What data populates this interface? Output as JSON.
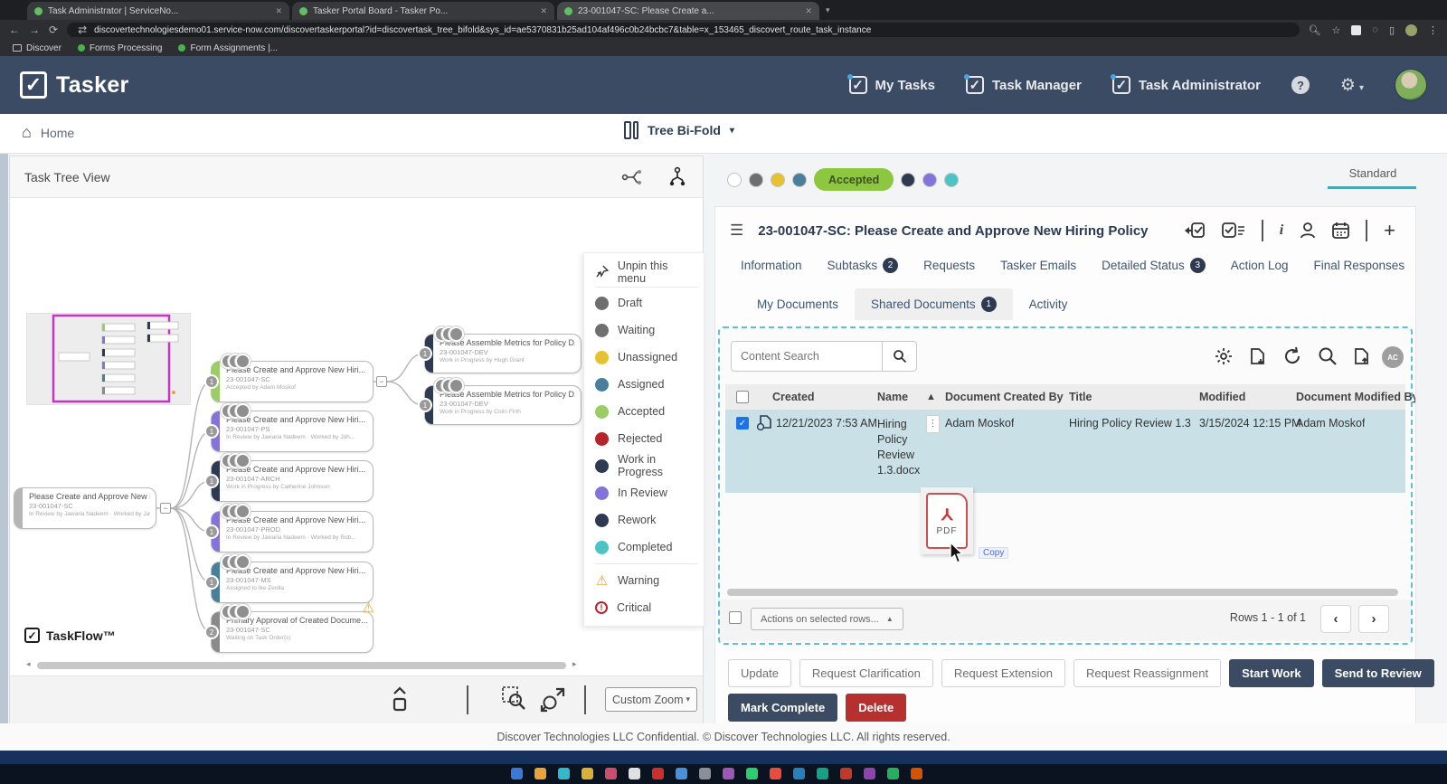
{
  "browser": {
    "tabs": [
      {
        "title": "Task Administrator | ServiceNo..."
      },
      {
        "title": "Tasker Portal Board - Tasker Po..."
      },
      {
        "title": "23-001047-SC: Please Create a..."
      }
    ],
    "url": "discovertechnologiesdemo01.service-now.com/discovertaskerportal?id=discovertask_tree_bifold&sys_id=ae5370831b25ad104af496c0b24bcbc7&table=x_153465_discovert_route_task_instance",
    "bookmarks": [
      "Discover",
      "Forms Processing",
      "Form Assignments |..."
    ]
  },
  "header": {
    "brand": "Tasker",
    "nav": [
      {
        "label": "My Tasks"
      },
      {
        "label": "Task Manager"
      },
      {
        "label": "Task Administrator"
      }
    ],
    "help": "?"
  },
  "subnav": {
    "home": "Home",
    "view": "Tree Bi-Fold"
  },
  "tree": {
    "title": "Task Tree View",
    "brand": "TaskFlow™",
    "zoom_label": "Custom Zoom",
    "legend": {
      "unpin": "Unpin this menu",
      "items": [
        {
          "label": "Draft",
          "color": "#6e6e6e"
        },
        {
          "label": "Waiting",
          "color": "#6e6e6e"
        },
        {
          "label": "Unassigned",
          "color": "#e6c230"
        },
        {
          "label": "Assigned",
          "color": "#4a7f9c"
        },
        {
          "label": "Accepted",
          "color": "#9ccc65"
        },
        {
          "label": "Rejected",
          "color": "#b5232b"
        },
        {
          "label": "Work in Progress",
          "color": "#2e3a52"
        },
        {
          "label": "In Review",
          "color": "#8274d8"
        },
        {
          "label": "Rework",
          "color": "#2e3a52"
        },
        {
          "label": "Completed",
          "color": "#4dc4c4"
        }
      ],
      "warning": "Warning",
      "critical": "Critical"
    },
    "nodes": [
      {
        "title": "Please Create and Approve New Hiri...",
        "id": "23-001047-SC",
        "status": "In Review by Jawaria Nadeem · Worked by Jav...",
        "color": "#b5b5b5",
        "badge": "1"
      },
      {
        "title": "Please Create and Approve New Hiri...",
        "id": "23-001047-SC",
        "status": "Accepted by Adam Moskof",
        "color": "#9ccc65",
        "badge": "1"
      },
      {
        "title": "Please Create and Approve New Hiri...",
        "id": "23-001047-PS",
        "status": "In Review by Jawaria Nadeem · Worked by Joh...",
        "color": "#8274d8",
        "badge": "1"
      },
      {
        "title": "Please Create and Approve New Hiri...",
        "id": "23-001047-ARCH",
        "status": "Work in Progress by Catherine Johnson",
        "color": "#2e3a52",
        "badge": "1"
      },
      {
        "title": "Please Create and Approve New Hiri...",
        "id": "23-001047-PROD",
        "status": "In Review by Jawaria Nadeem · Worked by Rob...",
        "color": "#8274d8",
        "badge": "1"
      },
      {
        "title": "Please Create and Approve New Hiri...",
        "id": "23-001047-MS",
        "status": "Assigned to Ike Zeolla",
        "color": "#4a7f9c",
        "badge": "1"
      },
      {
        "title": "Primary Approval of Created Docume...",
        "id": "23-001047-SC",
        "status": "Waiting on Task Order(s)",
        "color": "#8a8a8a",
        "badge": "2"
      },
      {
        "title": "Please Assemble Metrics for Policy D...",
        "id": "23-001047-DEV",
        "status": "Work in Progress by Hugh Grant",
        "color": "#2e3a52",
        "badge": "1"
      },
      {
        "title": "Please Assemble Metrics for Policy D...",
        "id": "23-001047-DEV",
        "status": "Work in Progress by Colin Firth",
        "color": "#2e3a52",
        "badge": "1"
      }
    ]
  },
  "status_bar": {
    "dots": [
      "#ffffff",
      "#6e6e6e",
      "#e6c230",
      "#4a7f9c",
      "#2e3a52",
      "#8274d8",
      "#4dc4c4"
    ],
    "pill": "Accepted",
    "view_tab": "Standard",
    "accent": "#4aa6b5"
  },
  "task_panel": {
    "title": "23-001047-SC: Please Create and Approve New Hiring Policy",
    "tabs_row1": [
      {
        "label": "Information"
      },
      {
        "label": "Subtasks",
        "badge": "2"
      },
      {
        "label": "Requests"
      },
      {
        "label": "Tasker Emails"
      },
      {
        "label": "Detailed Status",
        "badge": "3"
      },
      {
        "label": "Action Log"
      },
      {
        "label": "Final Responses"
      }
    ],
    "tabs_row2": [
      {
        "label": "My Documents"
      },
      {
        "label": "Shared Documents",
        "badge": "1"
      },
      {
        "label": "Activity"
      }
    ],
    "documents": {
      "search_placeholder": "Content Search",
      "avatar_initials": "AC",
      "columns": [
        "Created",
        "Name",
        "Document Created By",
        "Title",
        "Modified",
        "Document Modified By"
      ],
      "row": {
        "created": "12/21/2023 7:53 AM",
        "name": "Hiring Policy Review 1.3.docx",
        "created_by": "Adam Moskof",
        "title": "Hiring Policy Review 1.3",
        "modified": "3/15/2024 12:15 PM",
        "modified_by": "Adam Moskof"
      },
      "pdf_label": "PDF",
      "copy_tooltip": "Copy",
      "actions_label": "Actions on selected rows...",
      "rows_info": "Rows 1 - 1 of 1"
    },
    "buttons_row1": [
      "Update",
      "Request Clarification",
      "Request Extension",
      "Request Reassignment",
      "Start Work",
      "Send to Review"
    ],
    "buttons_row2": [
      "Mark Complete",
      "Delete"
    ],
    "colors": {
      "navy": "#3c4b64",
      "delete": "#b5302e",
      "selected_row": "#c9e0e6",
      "accepted": "#8dc63f"
    }
  },
  "footer": {
    "text": "Discover Technologies LLC Confidential. © Discover Technologies LLC. All rights reserved."
  },
  "taskbar": {
    "icon_colors": [
      "#3b78d8",
      "#e8a33d",
      "#35b8c9",
      "#d8b13a",
      "#c94f6d",
      "#e0e0e0",
      "#c9302c",
      "#4a90d9",
      "#8a8f98",
      "#9b59b6",
      "#2ecc71",
      "#e74c3c",
      "#2980b9",
      "#16a085",
      "#c0392b",
      "#8e44ad",
      "#27ae60",
      "#d35400"
    ]
  }
}
